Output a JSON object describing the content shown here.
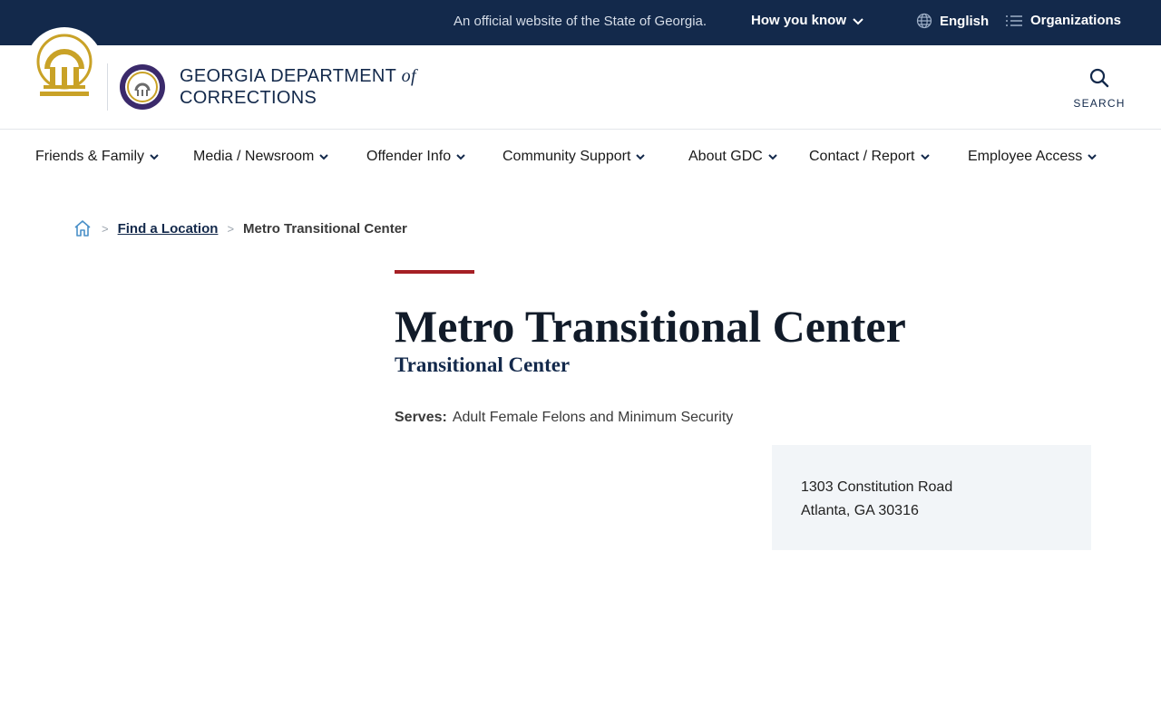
{
  "topbar": {
    "official_text": "An official website of the State of Georgia.",
    "how_you_know": "How you know",
    "language": "English",
    "organizations": "Organizations"
  },
  "header": {
    "agency_line1": "GEORGIA DEPARTMENT",
    "agency_of": "of",
    "agency_line2": "CORRECTIONS",
    "search_label": "SEARCH"
  },
  "nav": {
    "items": [
      {
        "label": "Friends & Family"
      },
      {
        "label": "Media / Newsroom"
      },
      {
        "label": "Offender Info"
      },
      {
        "label": "Community Support"
      },
      {
        "label": "About GDC"
      },
      {
        "label": "Contact / Report"
      },
      {
        "label": "Employee Access"
      }
    ]
  },
  "breadcrumb": {
    "link": "Find a Location",
    "current": "Metro Transitional Center"
  },
  "page": {
    "title": "Metro Transitional Center",
    "subtitle": "Transitional Center",
    "serves_label": "Serves:",
    "serves_value": "Adult Female Felons and Minimum Security",
    "address_line1": "1303 Constitution Road",
    "address_line2": "Atlanta, GA 30316"
  },
  "colors": {
    "topbar": "#13294b",
    "accent_red": "#a51f24",
    "gold": "#c9a227",
    "address_bg": "#f2f5f8"
  }
}
